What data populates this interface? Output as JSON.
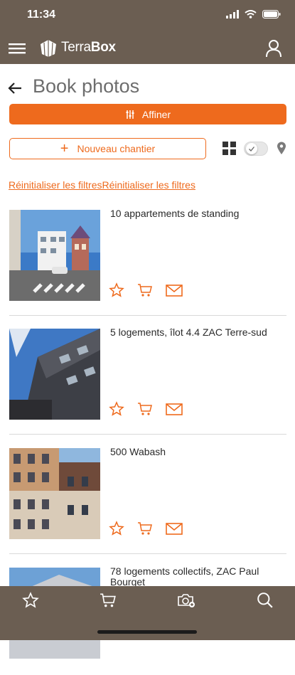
{
  "status": {
    "time": "11:34"
  },
  "header": {
    "logo_part1": "Terra",
    "logo_part2": "Box"
  },
  "page": {
    "title": "Book photos"
  },
  "toolbar": {
    "refine_label": "Affiner",
    "new_site_plus": "+",
    "new_site_label": "Nouveau chantier",
    "reset_label": "Réinitialiser les filtresRéinitialiser les filtres"
  },
  "items": [
    {
      "title": "10 appartements de standing"
    },
    {
      "title": "5 logements, îlot 4.4 ZAC Terre-sud"
    },
    {
      "title": "500 Wabash"
    },
    {
      "title": "78 logements collectifs, ZAC Paul Bourget"
    }
  ],
  "colors": {
    "accent": "#ee6a1d",
    "bar": "#6b5e52"
  },
  "icons": {
    "menu": "hamburger-icon",
    "user": "user-icon",
    "back": "arrow-left-icon",
    "refine": "sliders-icon",
    "grid": "grid-icon",
    "map": "map-pin-icon",
    "favorite": "star-icon",
    "cart": "cart-icon",
    "mail": "mail-icon",
    "camera": "camera-icon",
    "search": "search-icon"
  }
}
